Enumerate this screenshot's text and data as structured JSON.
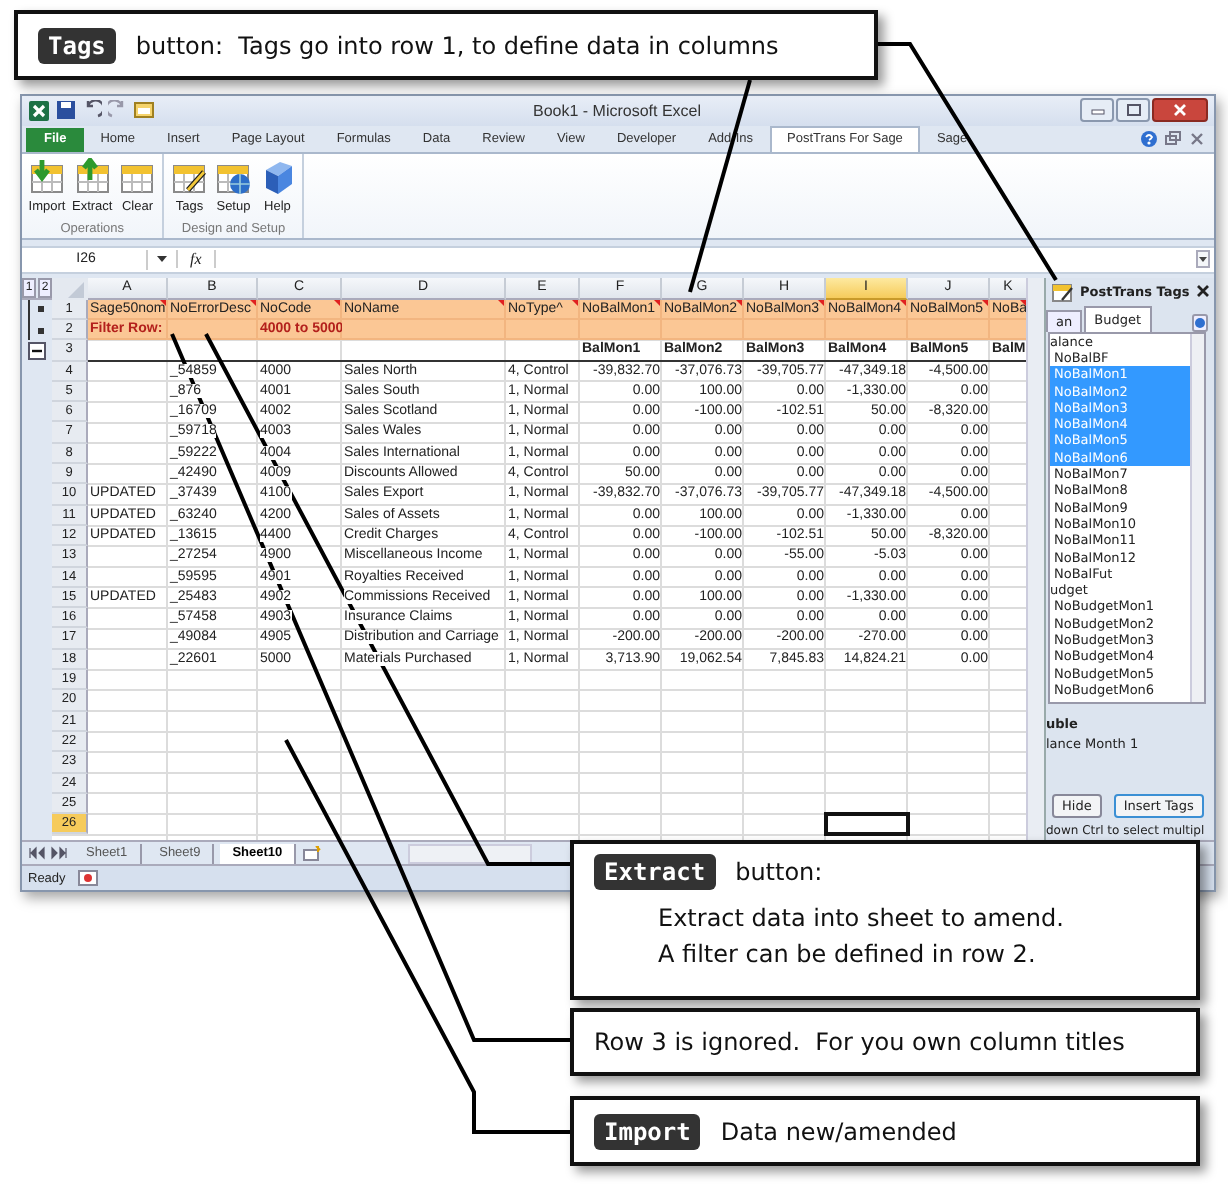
{
  "window": {
    "title": "Book1 - Microsoft Excel",
    "ribbon_tabs": [
      {
        "label": "File",
        "kind": "file",
        "selected": false
      },
      {
        "label": "Home",
        "kind": "tab",
        "selected": false
      },
      {
        "label": "Insert",
        "kind": "tab",
        "selected": false
      },
      {
        "label": "Page Layout",
        "kind": "tab",
        "selected": false
      },
      {
        "label": "Formulas",
        "kind": "tab",
        "selected": false
      },
      {
        "label": "Data",
        "kind": "tab",
        "selected": false
      },
      {
        "label": "Review",
        "kind": "tab",
        "selected": false
      },
      {
        "label": "View",
        "kind": "tab",
        "selected": false
      },
      {
        "label": "Developer",
        "kind": "tab",
        "selected": false
      },
      {
        "label": "Add-Ins",
        "kind": "tab",
        "selected": false
      },
      {
        "label": "PostTrans For Sage",
        "kind": "tab",
        "selected": true
      },
      {
        "label": "Sage",
        "kind": "tab",
        "selected": false
      }
    ],
    "ribbon_groups": [
      {
        "label": "Operations",
        "buttons": [
          "Import",
          "Extract",
          "Clear"
        ]
      },
      {
        "label": "Design and Setup",
        "buttons": [
          "Tags",
          "Setup",
          "Help"
        ]
      }
    ],
    "formula_bar": {
      "name_box": "I26",
      "function_label": "fx"
    },
    "outline_levels": [
      "1",
      "2"
    ],
    "sheet": {
      "columns": [
        {
          "label": "A",
          "selected": false
        },
        {
          "label": "B",
          "selected": false
        },
        {
          "label": "C",
          "selected": false
        },
        {
          "label": "D",
          "selected": false
        },
        {
          "label": "E",
          "selected": false
        },
        {
          "label": "F",
          "selected": false
        },
        {
          "label": "G",
          "selected": false
        },
        {
          "label": "H",
          "selected": false
        },
        {
          "label": "I",
          "selected": true
        },
        {
          "label": "J",
          "selected": false
        },
        {
          "label": "K",
          "selected": false
        }
      ],
      "rows": [
        {
          "number": "1",
          "kind": "tags",
          "selected": false,
          "cells": {
            "A": "Sage50nom",
            "B": "NoErrorDesc",
            "C": "NoCode",
            "D": "NoName",
            "E": "NoType^",
            "F": "NoBalMon1",
            "G": "NoBalMon2",
            "H": "NoBalMon3",
            "I": "NoBalMon4",
            "J": "NoBalMon5",
            "K": "NoBa"
          }
        },
        {
          "number": "2",
          "kind": "filter",
          "selected": false,
          "cells": {
            "A": "Filter Row:",
            "C": "4000 to 5000"
          }
        },
        {
          "number": "3",
          "kind": "titles",
          "selected": false,
          "cells": {
            "F": "BalMon1",
            "G": "BalMon2",
            "H": "BalMon3",
            "I": "BalMon4",
            "J": "BalMon5",
            "K": "BalM"
          }
        },
        {
          "number": "4",
          "kind": "data",
          "selected": false,
          "cells": {
            "B": "_54859",
            "C": "4000",
            "D": "Sales North",
            "E": "4, Control",
            "F": "-39,832.70",
            "G": "-37,076.73",
            "H": "-39,705.77",
            "I": "-47,349.18",
            "J": "-4,500.00"
          }
        },
        {
          "number": "5",
          "kind": "data",
          "selected": false,
          "cells": {
            "B": "_876",
            "C": "4001",
            "D": "Sales South",
            "E": "1, Normal",
            "F": "0.00",
            "G": "100.00",
            "H": "0.00",
            "I": "-1,330.00",
            "J": "0.00"
          }
        },
        {
          "number": "6",
          "kind": "data",
          "selected": false,
          "cells": {
            "B": "_16709",
            "C": "4002",
            "D": "Sales Scotland",
            "E": "1, Normal",
            "F": "0.00",
            "G": "-100.00",
            "H": "-102.51",
            "I": "50.00",
            "J": "-8,320.00"
          }
        },
        {
          "number": "7",
          "kind": "data",
          "selected": false,
          "cells": {
            "B": "_59718",
            "C": "4003",
            "D": "Sales Wales",
            "E": "1, Normal",
            "F": "0.00",
            "G": "0.00",
            "H": "0.00",
            "I": "0.00",
            "J": "0.00"
          }
        },
        {
          "number": "8",
          "kind": "data",
          "selected": false,
          "cells": {
            "B": "_59222",
            "C": "4004",
            "D": "Sales International",
            "E": "1, Normal",
            "F": "0.00",
            "G": "0.00",
            "H": "0.00",
            "I": "0.00",
            "J": "0.00"
          }
        },
        {
          "number": "9",
          "kind": "data",
          "selected": false,
          "cells": {
            "B": "_42490",
            "C": "4009",
            "D": "Discounts Allowed",
            "E": "4, Control",
            "F": "50.00",
            "G": "0.00",
            "H": "0.00",
            "I": "0.00",
            "J": "0.00"
          }
        },
        {
          "number": "10",
          "kind": "data",
          "selected": false,
          "cells": {
            "A": "UPDATED",
            "B": "_37439",
            "C": "4100",
            "D": "Sales Export",
            "E": "1, Normal",
            "F": "-39,832.70",
            "G": "-37,076.73",
            "H": "-39,705.77",
            "I": "-47,349.18",
            "J": "-4,500.00"
          }
        },
        {
          "number": "11",
          "kind": "data",
          "selected": false,
          "cells": {
            "A": "UPDATED",
            "B": "_63240",
            "C": "4200",
            "D": "Sales of Assets",
            "E": "1, Normal",
            "F": "0.00",
            "G": "100.00",
            "H": "0.00",
            "I": "-1,330.00",
            "J": "0.00"
          }
        },
        {
          "number": "12",
          "kind": "data",
          "selected": false,
          "cells": {
            "A": "UPDATED",
            "B": "_13615",
            "C": "4400",
            "D": "Credit Charges",
            "E": "4, Control",
            "F": "0.00",
            "G": "-100.00",
            "H": "-102.51",
            "I": "50.00",
            "J": "-8,320.00"
          }
        },
        {
          "number": "13",
          "kind": "data",
          "selected": false,
          "cells": {
            "B": "_27254",
            "C": "4900",
            "D": "Miscellaneous Income",
            "E": "1, Normal",
            "F": "0.00",
            "G": "0.00",
            "H": "-55.00",
            "I": "-5.03",
            "J": "0.00"
          }
        },
        {
          "number": "14",
          "kind": "data",
          "selected": false,
          "cells": {
            "B": "_59595",
            "C": "4901",
            "D": "Royalties Received",
            "E": "1, Normal",
            "F": "0.00",
            "G": "0.00",
            "H": "0.00",
            "I": "0.00",
            "J": "0.00"
          }
        },
        {
          "number": "15",
          "kind": "data",
          "selected": false,
          "cells": {
            "A": "UPDATED",
            "B": "_25483",
            "C": "4902",
            "D": "Commissions Received",
            "E": "1, Normal",
            "F": "0.00",
            "G": "100.00",
            "H": "0.00",
            "I": "-1,330.00",
            "J": "0.00"
          }
        },
        {
          "number": "16",
          "kind": "data",
          "selected": false,
          "cells": {
            "B": "_57458",
            "C": "4903",
            "D": "Insurance Claims",
            "E": "1, Normal",
            "F": "0.00",
            "G": "0.00",
            "H": "0.00",
            "I": "0.00",
            "J": "0.00"
          }
        },
        {
          "number": "17",
          "kind": "data",
          "selected": false,
          "cells": {
            "B": "_49084",
            "C": "4905",
            "D": "Distribution and Carriage",
            "E": "1, Normal",
            "F": "-200.00",
            "G": "-200.00",
            "H": "-200.00",
            "I": "-270.00",
            "J": "0.00"
          }
        },
        {
          "number": "18",
          "kind": "data",
          "selected": false,
          "cells": {
            "B": "_22601",
            "C": "5000",
            "D": "Materials Purchased",
            "E": "1, Normal",
            "F": "3,713.90",
            "G": "19,062.54",
            "H": "7,845.83",
            "I": "14,824.21",
            "J": "0.00"
          }
        },
        {
          "number": "19",
          "kind": "data",
          "selected": false
        },
        {
          "number": "20",
          "kind": "data",
          "selected": false
        },
        {
          "number": "21",
          "kind": "data",
          "selected": false
        },
        {
          "number": "22",
          "kind": "data",
          "selected": false
        },
        {
          "number": "23",
          "kind": "data",
          "selected": false
        },
        {
          "number": "24",
          "kind": "data",
          "selected": false
        },
        {
          "number": "25",
          "kind": "data",
          "selected": false
        },
        {
          "number": "26",
          "kind": "data",
          "selected": true
        }
      ]
    },
    "sheet_tabs": [
      {
        "label": "Sheet1",
        "selected": false
      },
      {
        "label": "Sheet9",
        "selected": false
      },
      {
        "label": "Sheet10",
        "selected": true
      }
    ],
    "status_bar": {
      "text": "Ready"
    },
    "task_pane": {
      "title": "PostTrans Tags",
      "tabs": [
        {
          "label": "an",
          "selected": false
        },
        {
          "label": "Budget",
          "selected": true
        }
      ],
      "items": [
        {
          "label": "alance",
          "kind": "group",
          "selected": false
        },
        {
          "label": "NoBalBF",
          "kind": "item",
          "selected": false
        },
        {
          "label": "NoBalMon1",
          "kind": "item",
          "selected": true
        },
        {
          "label": "NoBalMon2",
          "kind": "item",
          "selected": true
        },
        {
          "label": "NoBalMon3",
          "kind": "item",
          "selected": true
        },
        {
          "label": "NoBalMon4",
          "kind": "item",
          "selected": true
        },
        {
          "label": "NoBalMon5",
          "kind": "item",
          "selected": true
        },
        {
          "label": "NoBalMon6",
          "kind": "item",
          "selected": true
        },
        {
          "label": "NoBalMon7",
          "kind": "item",
          "selected": false
        },
        {
          "label": "NoBalMon8",
          "kind": "item",
          "selected": false
        },
        {
          "label": "NoBalMon9",
          "kind": "item",
          "selected": false
        },
        {
          "label": "NoBalMon10",
          "kind": "item",
          "selected": false
        },
        {
          "label": "NoBalMon11",
          "kind": "item",
          "selected": false
        },
        {
          "label": "NoBalMon12",
          "kind": "item",
          "selected": false
        },
        {
          "label": "NoBalFut",
          "kind": "item",
          "selected": false
        },
        {
          "label": "udget",
          "kind": "group",
          "selected": false
        },
        {
          "label": "NoBudgetMon1",
          "kind": "item",
          "selected": false
        },
        {
          "label": "NoBudgetMon2",
          "kind": "item",
          "selected": false
        },
        {
          "label": "NoBudgetMon3",
          "kind": "item",
          "selected": false
        },
        {
          "label": "NoBudgetMon4",
          "kind": "item",
          "selected": false
        },
        {
          "label": "NoBudgetMon5",
          "kind": "item",
          "selected": false
        },
        {
          "label": "NoBudgetMon6",
          "kind": "item",
          "selected": false
        }
      ],
      "description_title": "uble",
      "description": "lance Month 1",
      "buttons": [
        "Hide",
        "Insert Tags"
      ],
      "hint": "down Ctrl to select multipl"
    }
  },
  "callouts": [
    {
      "badge": "Tags",
      "lines": [
        "button:  Tags go into row 1, to define data in columns"
      ]
    },
    {
      "badge": "Extract",
      "lines": [
        "button:",
        "Extract data into sheet to amend.",
        "A filter can be defined in row 2."
      ]
    },
    {
      "lines": [
        "Row 3 is ignored.  For you own column titles"
      ]
    },
    {
      "badge": "Import",
      "lines": [
        "Data new/amended"
      ]
    }
  ]
}
